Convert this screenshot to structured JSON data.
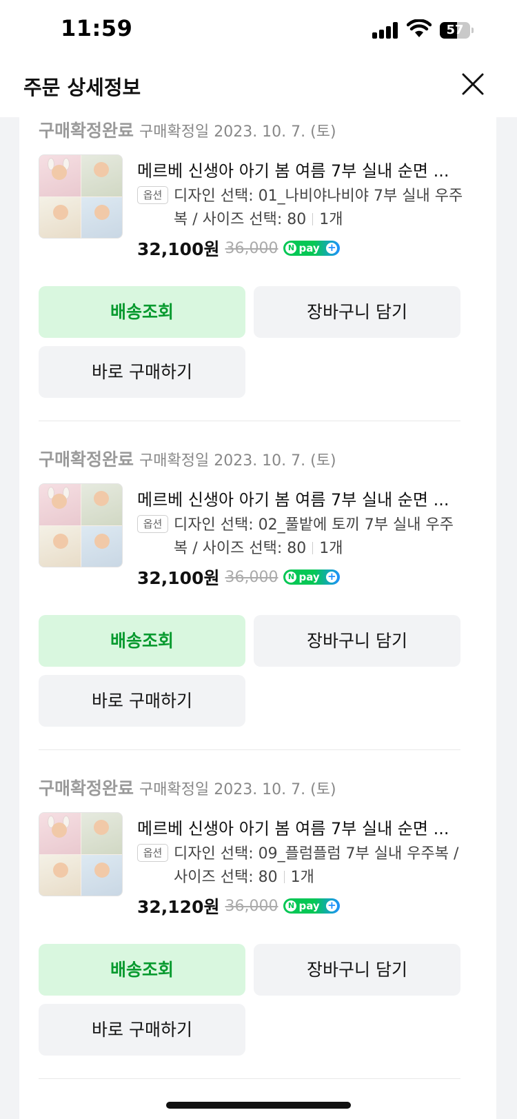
{
  "status_bar": {
    "time": "11:59",
    "battery": "57",
    "battery_level": 0.57
  },
  "header": {
    "title": "주문 상세정보",
    "close_icon": "close-icon"
  },
  "orders": [
    {
      "status": "구매확정완료",
      "confirm_date": "구매확정일 2023. 10. 7. (토)",
      "product_name": "메르베 신생아 아기 봄 여름 7부 실내 순면 ...",
      "option_chip": "옵션",
      "option_text": "디자인 선택: 01_나비야나비야 7부 실내 우주복 / 사이즈 선택: 80",
      "quantity": "1개",
      "price": "32,100원",
      "original_price": "36,000",
      "pay_badge": "pay",
      "buttons": {
        "track": "배송조회",
        "cart": "장바구니 담기",
        "buy": "바로 구매하기"
      }
    },
    {
      "status": "구매확정완료",
      "confirm_date": "구매확정일 2023. 10. 7. (토)",
      "product_name": "메르베 신생아 아기 봄 여름 7부 실내 순면 ...",
      "option_chip": "옵션",
      "option_text": "디자인 선택: 02_풀밭에 토끼 7부 실내 우주복 / 사이즈 선택: 80",
      "quantity": "1개",
      "price": "32,100원",
      "original_price": "36,000",
      "pay_badge": "pay",
      "buttons": {
        "track": "배송조회",
        "cart": "장바구니 담기",
        "buy": "바로 구매하기"
      }
    },
    {
      "status": "구매확정완료",
      "confirm_date": "구매확정일 2023. 10. 7. (토)",
      "product_name": "메르베 신생아 아기 봄 여름 7부 실내 순면 ...",
      "option_chip": "옵션",
      "option_text": "디자인 선택: 09_플럼플럼 7부 실내 우주복 / 사이즈 선택: 80",
      "quantity": "1개",
      "price": "32,120원",
      "original_price": "36,000",
      "pay_badge": "pay",
      "buttons": {
        "track": "배송조회",
        "cart": "장바구니 담기",
        "buy": "바로 구매하기"
      }
    }
  ],
  "colors": {
    "track_bg": "#d9f7df",
    "track_text": "#089a2f",
    "npay_green": "#06c755",
    "npay_blue": "#1e90ff"
  }
}
